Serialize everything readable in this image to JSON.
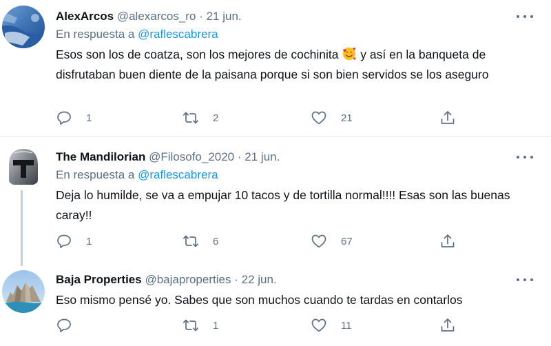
{
  "tweets": [
    {
      "name": "AlexArcos",
      "handle": "@alexarcos_ro",
      "separator": "·",
      "date": "21 jun.",
      "reply_prefix": "En respuesta a",
      "reply_mention": "@raflescabrera",
      "text_before_emoji": "Esos son los de coatza, son los mejores de cochinita",
      "emoji": "smiling-face-with-hearts",
      "text_after_emoji": " y así en la banqueta de disfrutaban buen diente de la paisana porque si son bien servidos se los aseguro",
      "replies": "1",
      "retweets": "2",
      "likes": "21"
    },
    {
      "name": "The Mandilorian",
      "handle": "@Filosofo_2020",
      "separator": "·",
      "date": "21 jun.",
      "reply_prefix": "En respuesta a",
      "reply_mention": "@raflescabrera",
      "text": "Deja lo humilde, se va a empujar 10 tacos y de tortilla normal!!!! Esas son las buenas caray!!",
      "replies": "1",
      "retweets": "6",
      "likes": "67"
    },
    {
      "name": "Baja Properties",
      "handle": "@bajaproperties",
      "separator": "·",
      "date": "22 jun.",
      "text": "Eso mismo pensé yo. Sabes que son muchos cuando te tardas en contarlos",
      "replies": "",
      "retweets": "1",
      "likes": "11"
    }
  ],
  "icons": {
    "reply": "reply-icon",
    "retweet": "retweet-icon",
    "like": "heart-icon",
    "share": "share-icon",
    "more": "more-options-icon"
  },
  "colors": {
    "text": "#0f1419",
    "secondary": "#5b7083",
    "link": "#1b95e0",
    "divider": "#e6ecf0"
  }
}
